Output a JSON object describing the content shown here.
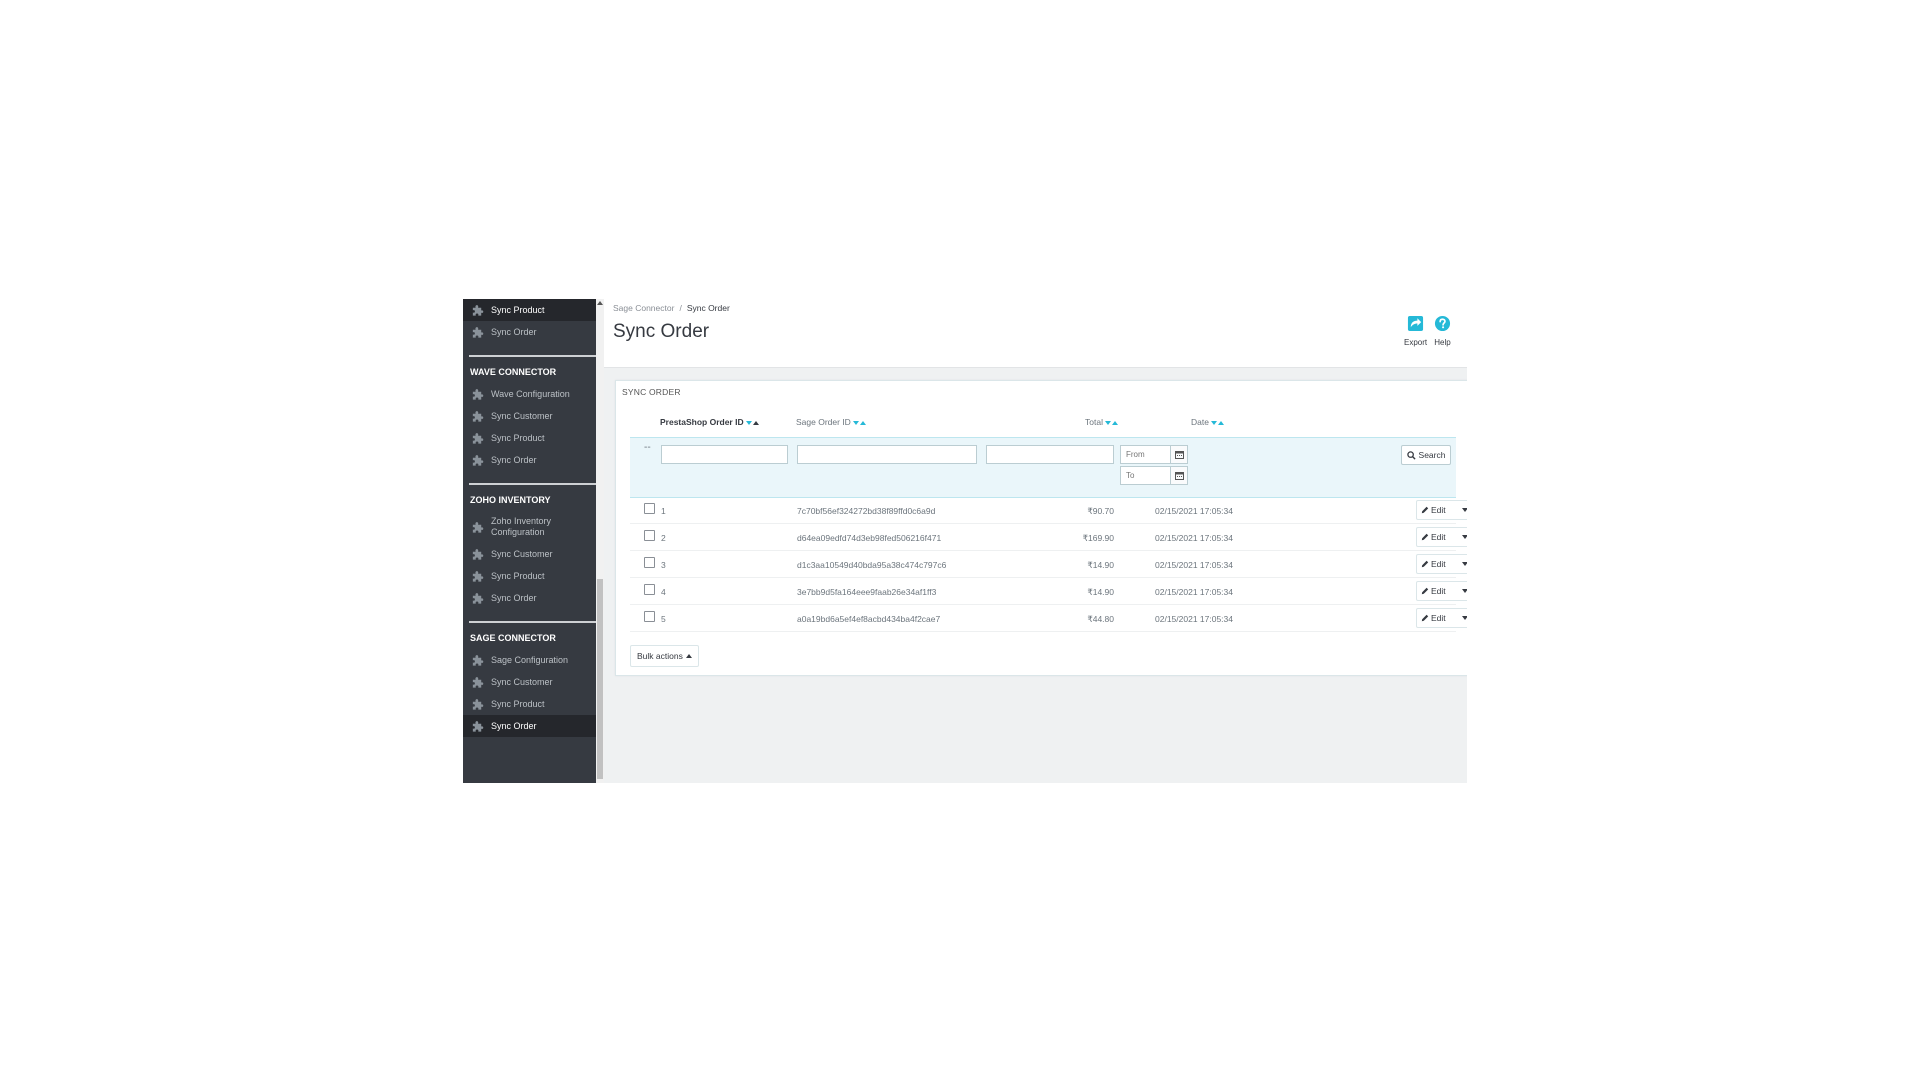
{
  "sidebar": {
    "top_items": [
      {
        "label": "Sync Product",
        "active": true
      },
      {
        "label": "Sync Order",
        "active": false
      }
    ],
    "sections": [
      {
        "title": "WAVE CONNECTOR",
        "items": [
          {
            "label": "Wave Configuration"
          },
          {
            "label": "Sync Customer"
          },
          {
            "label": "Sync Product"
          },
          {
            "label": "Sync Order"
          }
        ]
      },
      {
        "title": "ZOHO INVENTORY",
        "items": [
          {
            "label": "Zoho Inventory Configuration",
            "two_line": true
          },
          {
            "label": "Sync Customer"
          },
          {
            "label": "Sync Product"
          },
          {
            "label": "Sync Order"
          }
        ]
      },
      {
        "title": "SAGE CONNECTOR",
        "items": [
          {
            "label": "Sage Configuration"
          },
          {
            "label": "Sync Customer"
          },
          {
            "label": "Sync Product"
          },
          {
            "label": "Sync Order",
            "active": true
          }
        ]
      }
    ]
  },
  "header": {
    "breadcrumb_parent": "Sage Connector",
    "breadcrumb_sep": "/",
    "breadcrumb_current": "Sync Order",
    "title": "Sync Order",
    "export_label": "Export",
    "help_label": "Help"
  },
  "panel": {
    "heading": "SYNC ORDER",
    "columns": {
      "prestashop_id": "PrestaShop Order ID",
      "sage_id": "Sage Order ID",
      "total": "Total",
      "date": "Date"
    },
    "filter": {
      "dash": "--",
      "from_placeholder": "From",
      "to_placeholder": "To",
      "search_label": "Search"
    },
    "rows": [
      {
        "id": "1",
        "sage_id": "7c70bf56ef324272bd38f89ffd0c6a9d",
        "total": "₹90.70",
        "date": "02/15/2021 17:05:34"
      },
      {
        "id": "2",
        "sage_id": "d64ea09edfd74d3eb98fed506216f471",
        "total": "₹169.90",
        "date": "02/15/2021 17:05:34"
      },
      {
        "id": "3",
        "sage_id": "d1c3aa10549d40bda95a38c474c797c6",
        "total": "₹14.90",
        "date": "02/15/2021 17:05:34"
      },
      {
        "id": "4",
        "sage_id": "3e7bb9d5fa164eee9faab26e34af1ff3",
        "total": "₹14.90",
        "date": "02/15/2021 17:05:34"
      },
      {
        "id": "5",
        "sage_id": "a0a19bd6a5ef4ef8acbd434ba4f2cae7",
        "total": "₹44.80",
        "date": "02/15/2021 17:05:34"
      }
    ],
    "edit_label": "Edit",
    "bulk_label": "Bulk actions"
  },
  "colors": {
    "sidebar_bg": "#363a41",
    "accent": "#25b9d7"
  }
}
